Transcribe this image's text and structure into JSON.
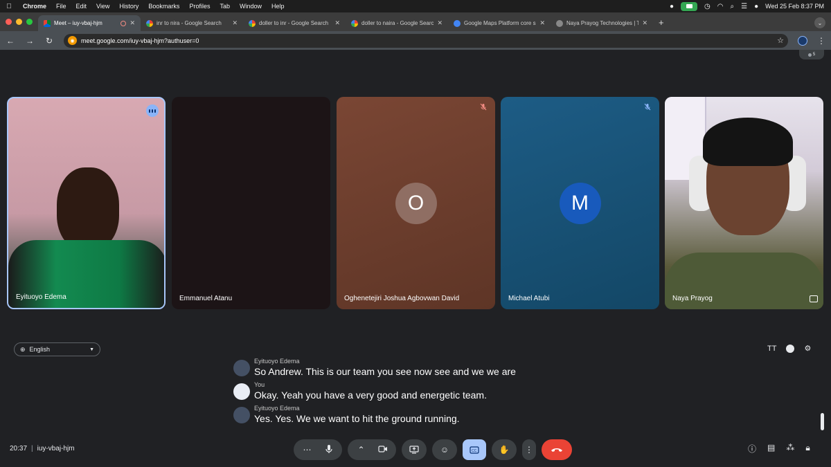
{
  "menubar": {
    "apple": "",
    "app_name": "Chrome",
    "items": [
      "File",
      "Edit",
      "View",
      "History",
      "Bookmarks",
      "Profiles",
      "Tab",
      "Window",
      "Help"
    ],
    "datetime": "Wed 25 Feb  8:37 PM"
  },
  "tabs": [
    {
      "title": "Meet – iuy-vbaj-hjm",
      "favicon": "meet-icon",
      "active": true
    },
    {
      "title": "inr to nira - Google Search",
      "favicon": "google-icon",
      "active": false
    },
    {
      "title": "doller to inr - Google Search",
      "favicon": "google-icon",
      "active": false
    },
    {
      "title": "doller to naira - Google Search",
      "favicon": "google-icon",
      "active": false
    },
    {
      "title": "Google Maps Platform core se",
      "favicon": "maps-icon",
      "active": false
    },
    {
      "title": "Naya Prayog Technologies | T",
      "favicon": "globe-icon",
      "active": false
    }
  ],
  "address_bar": {
    "url": "meet.google.com/iuy-vbaj-hjm?authuser=0"
  },
  "self_view_chip": {
    "label": "5"
  },
  "participants": [
    {
      "name": "Eyituoyo Edema",
      "state": "speaking"
    },
    {
      "name": "Emmanuel Atanu",
      "state": "video-off"
    },
    {
      "name": "Oghenetejiri Joshua Agbovwan David",
      "initial": "O",
      "state": "muted"
    },
    {
      "name": "Michael Atubi",
      "initial": "M",
      "state": "muted"
    },
    {
      "name": "Naya Prayog",
      "state": "video"
    }
  ],
  "captions": {
    "language": "English",
    "lines": [
      {
        "speaker": "Eyituoyo Edema",
        "text": "So Andrew. This is our team you see now see and we we are"
      },
      {
        "speaker": "You",
        "text": "Okay. Yeah you have a very good and energetic team."
      },
      {
        "speaker": "Eyituoyo Edema",
        "text": "Yes. Yes. We we want to hit the ground running."
      }
    ],
    "font_size_icon": "TT"
  },
  "meeting": {
    "time": "20:37",
    "code": "iuy-vbaj-hjm"
  },
  "controls": {
    "more": "⋯",
    "chevron": "⌃"
  },
  "colors": {
    "end_call": "#ea4335",
    "active_control": "#a8c7fa",
    "speaking_outline": "#a8c7fa"
  }
}
